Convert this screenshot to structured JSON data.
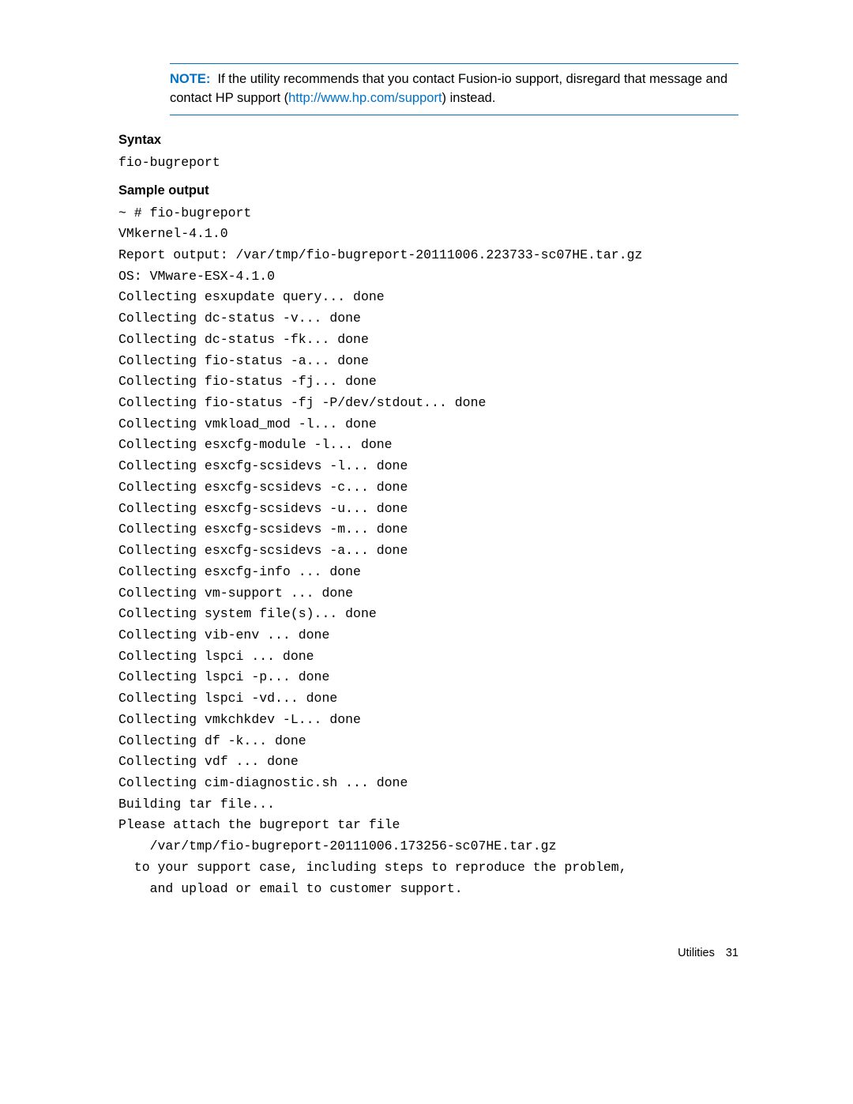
{
  "note": {
    "label": "NOTE:",
    "text_before_link": "If the utility recommends that you contact Fusion-io support, disregard that message and contact HP support (",
    "link_text": "http://www.hp.com/support",
    "text_after_link": ") instead."
  },
  "syntax": {
    "heading": "Syntax",
    "command": "fio-bugreport"
  },
  "sample": {
    "heading": "Sample output",
    "lines": [
      "~ # fio-bugreport",
      "VMkernel-4.1.0",
      "Report output: /var/tmp/fio-bugreport-20111006.223733-sc07HE.tar.gz",
      "OS: VMware-ESX-4.1.0",
      "Collecting esxupdate query... done",
      "Collecting dc-status -v... done",
      "Collecting dc-status -fk... done",
      "Collecting fio-status -a... done",
      "Collecting fio-status -fj... done",
      "Collecting fio-status -fj -P/dev/stdout... done",
      "Collecting vmkload_mod -l... done",
      "Collecting esxcfg-module -l... done",
      "Collecting esxcfg-scsidevs -l... done",
      "Collecting esxcfg-scsidevs -c... done",
      "Collecting esxcfg-scsidevs -u... done",
      "Collecting esxcfg-scsidevs -m... done",
      "Collecting esxcfg-scsidevs -a... done",
      "Collecting esxcfg-info ... done",
      "Collecting vm-support ... done",
      "Collecting system file(s)... done",
      "Collecting vib-env ... done",
      "Collecting lspci ... done",
      "Collecting lspci -p... done",
      "Collecting lspci -vd... done",
      "Collecting vmkchkdev -L... done",
      "Collecting df -k... done",
      "Collecting vdf ... done",
      "Collecting cim-diagnostic.sh ... done",
      "Building tar file...",
      "Please attach the bugreport tar file",
      "    /var/tmp/fio-bugreport-20111006.173256-sc07HE.tar.gz",
      "  to your support case, including steps to reproduce the problem,",
      "    and upload or email to customer support."
    ]
  },
  "footer": {
    "section": "Utilities",
    "page": "31"
  }
}
